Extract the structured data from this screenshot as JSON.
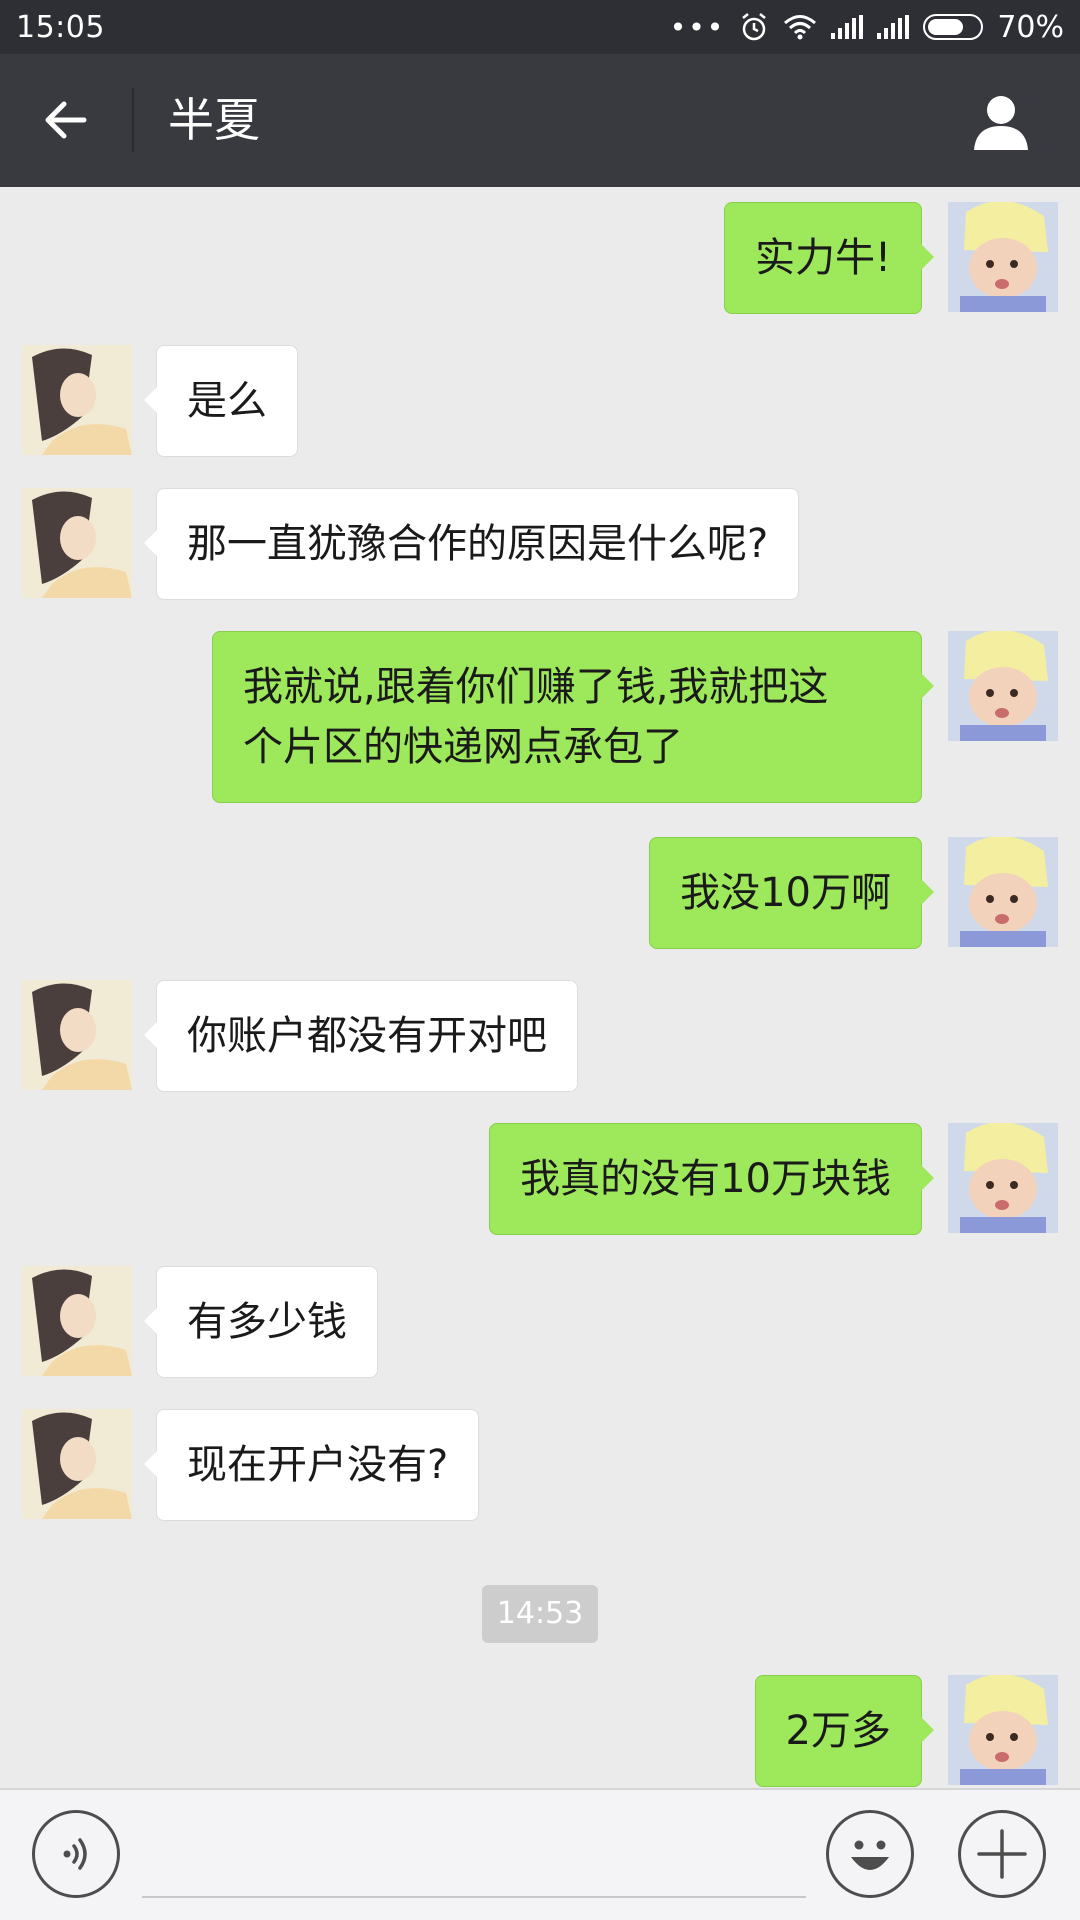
{
  "status_bar": {
    "time": "15:05",
    "more_indicator": "•••",
    "battery_percent": "70%",
    "battery_level": 0.7,
    "icons": [
      "alarm-icon",
      "wifi-icon",
      "signal-icon",
      "signal-icon",
      "battery-icon"
    ]
  },
  "header": {
    "back_icon": "back-arrow-icon",
    "title": "半夏",
    "profile_icon": "person-icon"
  },
  "messages": [
    {
      "sender": "me",
      "text": "实力牛!"
    },
    {
      "sender": "peer",
      "text": "是么"
    },
    {
      "sender": "peer",
      "text": "那一直犹豫合作的原因是什么呢?"
    },
    {
      "sender": "me",
      "text": "我就说,跟着你们赚了钱,我就把这\n个片区的快递网点承包了"
    },
    {
      "sender": "me",
      "text": "我没10万啊"
    },
    {
      "sender": "peer",
      "text": "你账户都没有开对吧"
    },
    {
      "sender": "me",
      "text": "我真的没有10万块钱"
    },
    {
      "sender": "peer",
      "text": "有多少钱"
    },
    {
      "sender": "peer",
      "text": "现在开户没有?"
    },
    {
      "sender": "me",
      "text": "2万多"
    }
  ],
  "timestamp": "14:53",
  "input_bar": {
    "voice_icon": "voice-icon",
    "emoji_icon": "emoji-icon",
    "plus_icon": "plus-icon",
    "input_value": ""
  },
  "colors": {
    "status_bar_bg": "#2e2f34",
    "title_bar_bg": "#393a3f",
    "chat_bg": "#ebebeb",
    "my_bubble": "#9ee85c",
    "peer_bubble": "#ffffff",
    "timestamp_bg": "#cdcdcd"
  }
}
